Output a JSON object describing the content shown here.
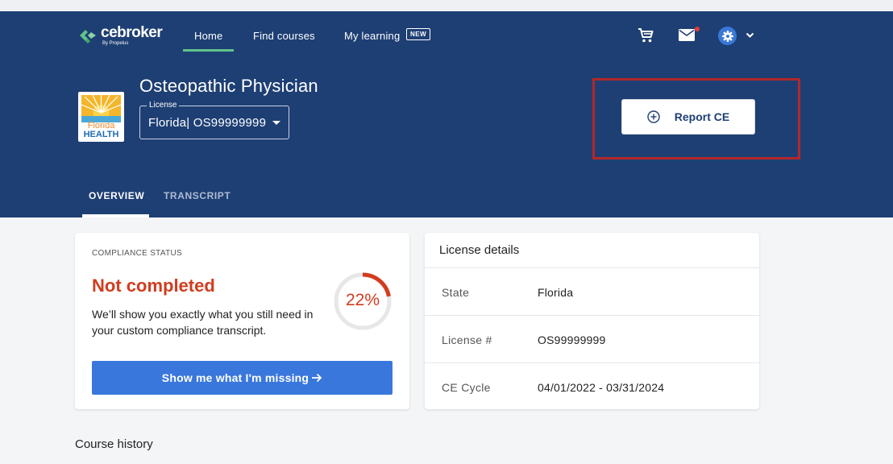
{
  "brand": {
    "name": "cebroker",
    "tagline": "By Propelus",
    "accent": "#5fc48a",
    "primary": "#1e3f74"
  },
  "nav": {
    "items": [
      {
        "label": "Home",
        "active": true
      },
      {
        "label": "Find courses",
        "active": false
      },
      {
        "label": "My learning",
        "active": false
      }
    ],
    "new_badge": "NEW",
    "icons": [
      "cart-icon",
      "mail-icon",
      "gear-icon",
      "chevron-down-icon"
    ],
    "mail_has_notification": true
  },
  "license_header": {
    "state_logo_text_1": "Florida",
    "state_logo_text_2": "HEALTH",
    "profession": "Osteopathic Physician",
    "license_legend": "License",
    "license_value": "Florida| OS99999999"
  },
  "report_button": {
    "label": "Report CE",
    "icon": "plus-circle-icon"
  },
  "tabs": [
    {
      "label": "OVERVIEW",
      "active": true
    },
    {
      "label": "TRANSCRIPT",
      "active": false
    }
  ],
  "compliance": {
    "section_label": "COMPLIANCE STATUS",
    "status": "Not completed",
    "status_color": "#d13c1f",
    "description": "We’ll show you exactly what you still need in your custom compliance transcript.",
    "progress_percent": 22,
    "progress_label": "22%",
    "button_label": "Show me what I'm missing",
    "button_color": "#3a77dd"
  },
  "license_details": {
    "title": "License details",
    "rows": [
      {
        "key": "State",
        "value": "Florida"
      },
      {
        "key": "License #",
        "value": "OS99999999"
      },
      {
        "key": "CE Cycle",
        "value": "04/01/2022 - 03/31/2024"
      }
    ]
  },
  "course_history": {
    "title": "Course history"
  }
}
